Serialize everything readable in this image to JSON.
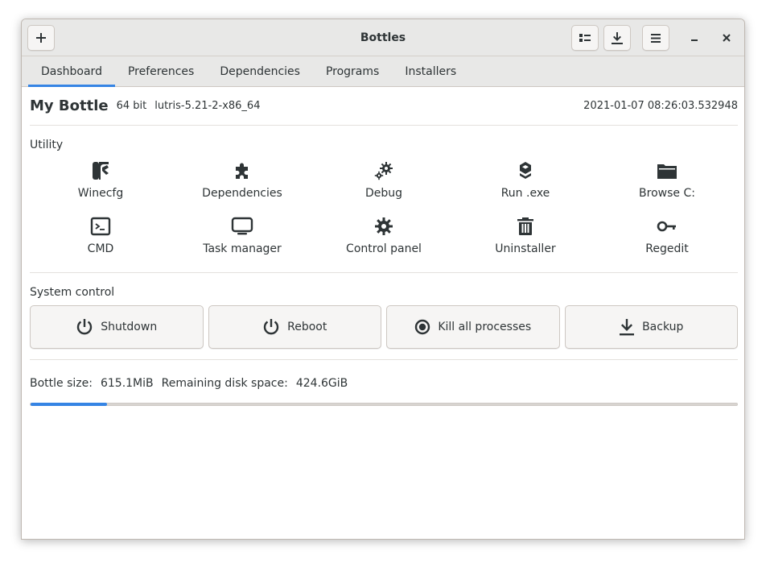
{
  "window": {
    "title": "Bottles",
    "new_button_icon": "plus-icon",
    "list_button_icon": "list-icon",
    "download_button_icon": "download-icon",
    "menu_button_icon": "hamburger-menu-icon",
    "minimize_icon": "minimize-icon",
    "close_icon": "close-icon"
  },
  "tabs": [
    {
      "label": "Dashboard",
      "active": true
    },
    {
      "label": "Preferences",
      "active": false
    },
    {
      "label": "Dependencies",
      "active": false
    },
    {
      "label": "Programs",
      "active": false
    },
    {
      "label": "Installers",
      "active": false
    }
  ],
  "bottle": {
    "name": "My Bottle",
    "arch": "64 bit",
    "runner": "lutris-5.21-2-x86_64",
    "date": "2021-01-07 08:26:03.532948"
  },
  "utility": {
    "title": "Utility",
    "items": [
      {
        "label": "Winecfg",
        "icon": "winecfg-icon"
      },
      {
        "label": "Dependencies",
        "icon": "puzzle-icon"
      },
      {
        "label": "Debug",
        "icon": "gears-icon"
      },
      {
        "label": "Run .exe",
        "icon": "run-exe-icon"
      },
      {
        "label": "Browse C:",
        "icon": "folder-icon"
      },
      {
        "label": "CMD",
        "icon": "terminal-icon"
      },
      {
        "label": "Task manager",
        "icon": "monitor-icon"
      },
      {
        "label": "Control panel",
        "icon": "gear-icon"
      },
      {
        "label": "Uninstaller",
        "icon": "trash-icon"
      },
      {
        "label": "Regedit",
        "icon": "key-icon"
      }
    ]
  },
  "system_control": {
    "title": "System control",
    "buttons": [
      {
        "label": "Shutdown",
        "icon": "power-icon"
      },
      {
        "label": "Reboot",
        "icon": "reboot-icon"
      },
      {
        "label": "Kill all processes",
        "icon": "stop-icon"
      },
      {
        "label": "Backup",
        "icon": "download-icon"
      }
    ]
  },
  "disk": {
    "bottle_size_label": "Bottle size:",
    "bottle_size_value": "615.1MiB",
    "remaining_label": "Remaining disk space:",
    "remaining_value": "424.6GiB",
    "usage_fraction": 0.108
  },
  "colors": {
    "accent": "#3584e4",
    "text": "#2e3436",
    "headerbar": "#e8e8e7"
  }
}
